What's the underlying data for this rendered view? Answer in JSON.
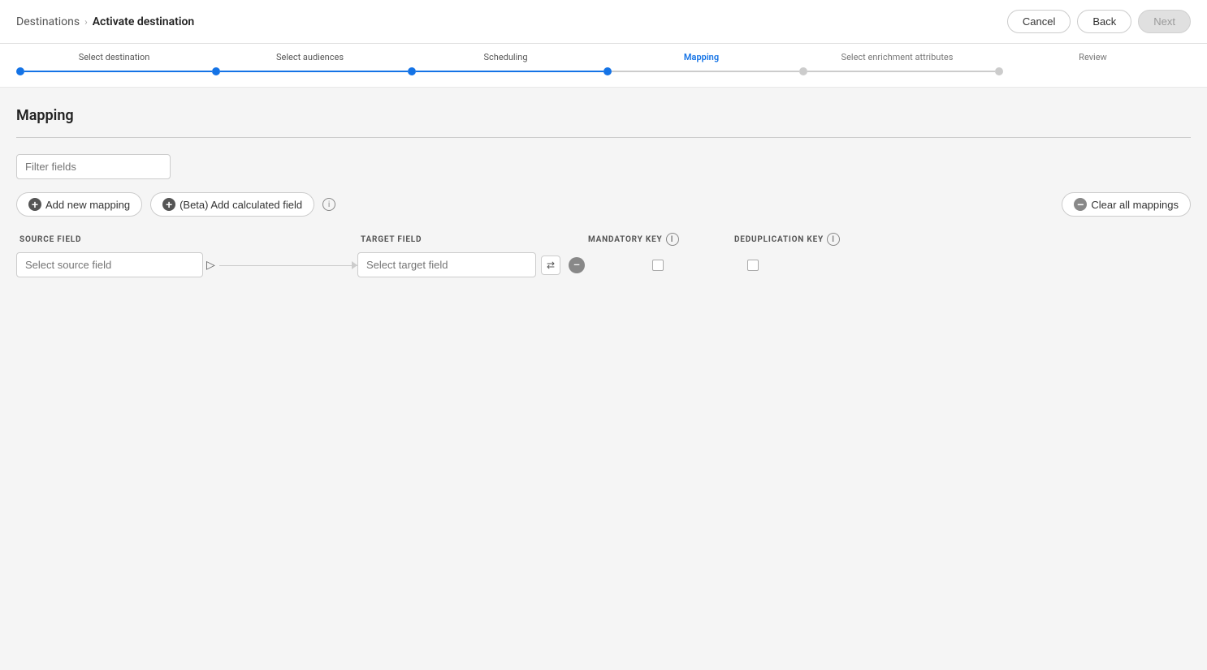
{
  "breadcrumb": {
    "link_label": "Destinations",
    "separator": "›",
    "current": "Activate destination"
  },
  "header_buttons": {
    "cancel": "Cancel",
    "back": "Back",
    "next": "Next"
  },
  "steps": [
    {
      "label": "Select destination",
      "state": "completed"
    },
    {
      "label": "Select audiences",
      "state": "completed"
    },
    {
      "label": "Scheduling",
      "state": "completed"
    },
    {
      "label": "Mapping",
      "state": "active"
    },
    {
      "label": "Select enrichment attributes",
      "state": "future"
    },
    {
      "label": "Review",
      "state": "future"
    }
  ],
  "mapping": {
    "section_title": "Mapping",
    "filter_placeholder": "Filter fields",
    "add_mapping_label": "Add new mapping",
    "add_calculated_label": "(Beta) Add calculated field",
    "clear_all_label": "Clear all mappings",
    "source_field_header": "SOURCE FIELD",
    "target_field_header": "TARGET FIELD",
    "mandatory_key_header": "MANDATORY KEY",
    "dedup_key_header": "DEDUPLICATION KEY",
    "row": {
      "source_placeholder": "Select source field",
      "target_placeholder": "Select target field"
    }
  }
}
